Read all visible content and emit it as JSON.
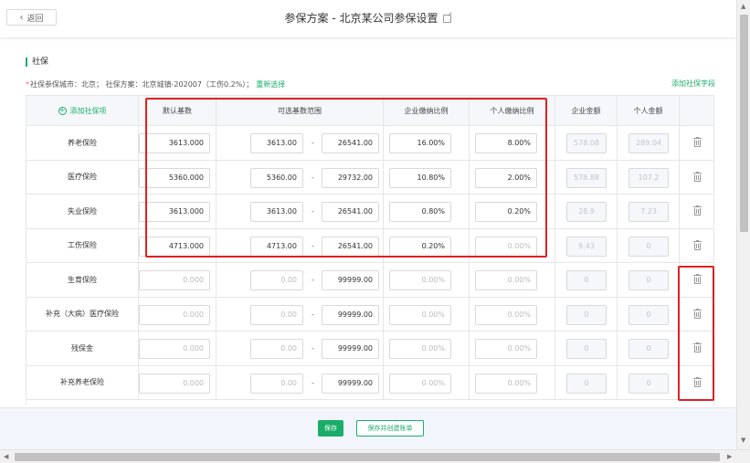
{
  "header": {
    "back_label": "返回",
    "title": "参保方案 - 北京某公司参保设置"
  },
  "section": {
    "title": "社保",
    "required_mark": "*",
    "info_prefix": "社保参保城市：北京；  社保方案：北京城镇-202007（工伤0.2%）；",
    "reselect_label": "重新选择",
    "add_field_label": "添加社保字段"
  },
  "table": {
    "headers": {
      "add_insurance": "添加社保项",
      "default_base": "默认基数",
      "range": "可选基数范围",
      "company_ratio": "企业缴纳比例",
      "personal_ratio": "个人缴纳比例",
      "company_amount": "企业金额",
      "personal_amount": "个人金额"
    },
    "rows": [
      {
        "name": "养老保险",
        "base": "3613.000",
        "min": "3613.00",
        "max": "26541.00",
        "company": "16.00%",
        "personal": "8.00%",
        "c_amt": "578.08",
        "p_amt": "289.04"
      },
      {
        "name": "医疗保险",
        "base": "5360.000",
        "min": "5360.00",
        "max": "29732.00",
        "company": "10.80%",
        "personal": "2.00%",
        "c_amt": "578.88",
        "p_amt": "107.2"
      },
      {
        "name": "失业保险",
        "base": "3613.000",
        "min": "3613.00",
        "max": "26541.00",
        "company": "0.80%",
        "personal": "0.20%",
        "c_amt": "28.9",
        "p_amt": "7.23"
      },
      {
        "name": "工伤保险",
        "base": "4713.000",
        "min": "4713.00",
        "max": "26541.00",
        "company": "0.20%",
        "personal": "0.00%",
        "c_amt": "9.43",
        "p_amt": "0"
      },
      {
        "name": "生育保险",
        "base": "0.000",
        "min": "0.00",
        "max": "99999.00",
        "company": "0.00%",
        "personal": "0.00%",
        "c_amt": "0",
        "p_amt": "0"
      },
      {
        "name": "补充（大病）医疗保险",
        "base": "0.000",
        "min": "0.00",
        "max": "99999.00",
        "company": "0.00%",
        "personal": "0.00%",
        "c_amt": "0",
        "p_amt": "0"
      },
      {
        "name": "残保金",
        "base": "0.000",
        "min": "0.00",
        "max": "99999.00",
        "company": "0.00%",
        "personal": "0.00%",
        "c_amt": "0",
        "p_amt": "0"
      },
      {
        "name": "补充养老保险",
        "base": "0.000",
        "min": "0.00",
        "max": "99999.00",
        "company": "0.00%",
        "personal": "0.00%",
        "c_amt": "0",
        "p_amt": "0"
      }
    ]
  },
  "footer": {
    "save_label": "保存",
    "save_create_label": "保存并创建账单"
  },
  "colors": {
    "accent": "#1aad6a",
    "highlight": "#e02020"
  }
}
